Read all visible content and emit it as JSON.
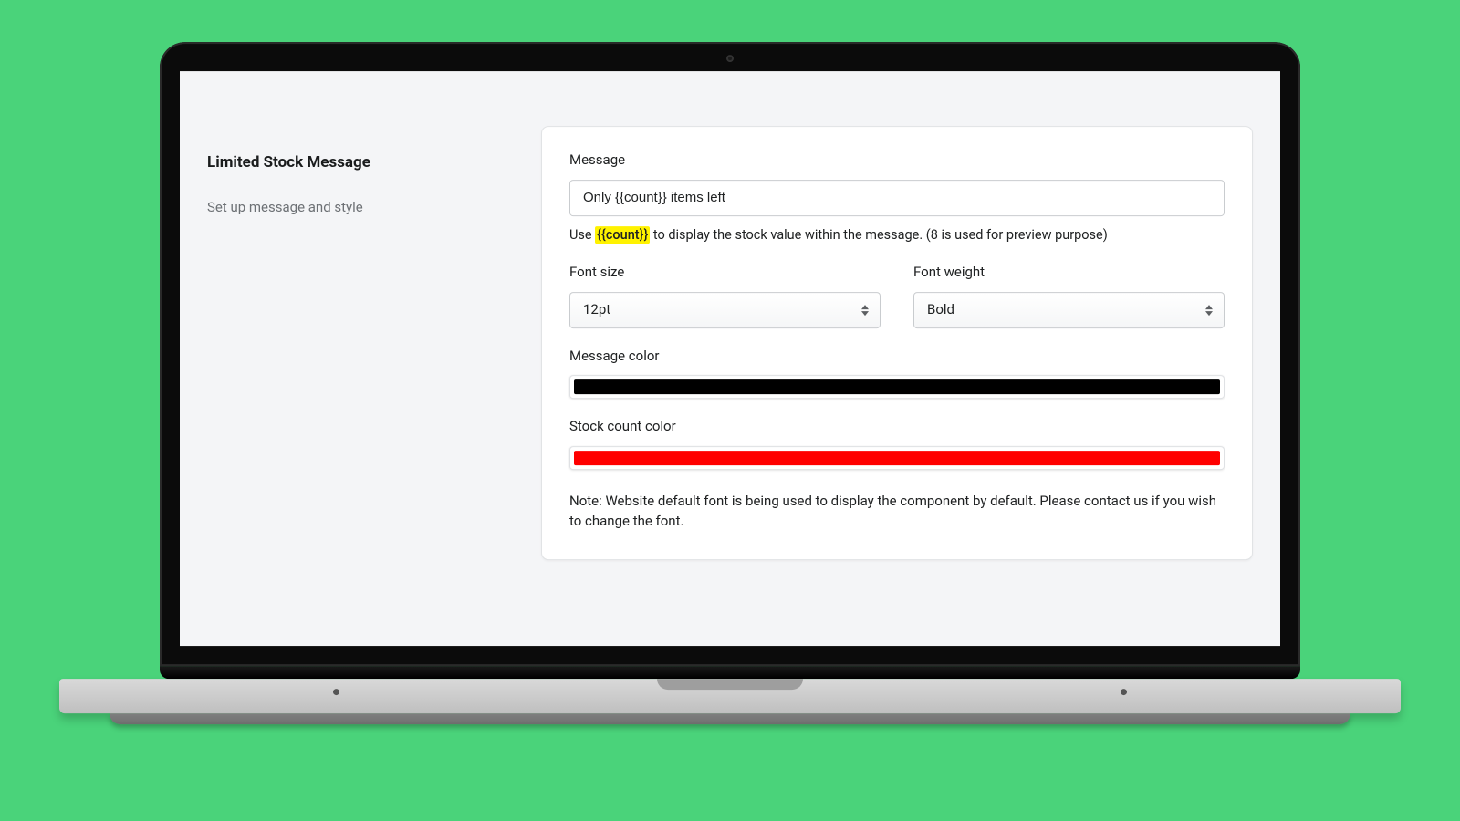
{
  "sidebar": {
    "title": "Limited Stock Message",
    "subtitle": "Set up message and style"
  },
  "form": {
    "message": {
      "label": "Message",
      "value": "Only {{count}} items left",
      "hint_pre": "Use ",
      "hint_token": "{{count}}",
      "hint_post": " to display the stock value within the message. (8 is used for preview purpose)"
    },
    "font_size": {
      "label": "Font size",
      "value": "12pt"
    },
    "font_weight": {
      "label": "Font weight",
      "value": "Bold"
    },
    "message_color": {
      "label": "Message color",
      "value": "#000000"
    },
    "stock_count_color": {
      "label": "Stock count color",
      "value": "#ff0000"
    },
    "note": "Note: Website default font is being used to display the component by default. Please contact us if you wish to change the font."
  }
}
